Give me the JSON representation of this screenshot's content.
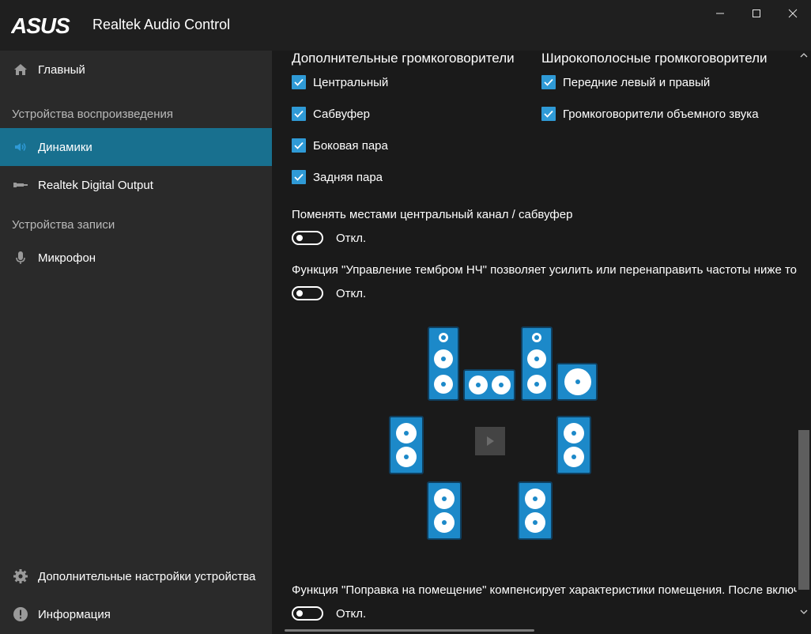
{
  "app": {
    "brand": "ASUS",
    "title": "Realtek Audio Control"
  },
  "window_controls": {
    "minimize_icon": "minimize-icon",
    "maximize_icon": "maximize-icon",
    "close_icon": "close-icon"
  },
  "sidebar": {
    "home": {
      "label": "Главный",
      "icon": "home-icon"
    },
    "playback_section": "Устройства воспроизведения",
    "playback_items": [
      {
        "label": "Динамики",
        "icon": "speaker-icon",
        "active": true
      },
      {
        "label": "Realtek Digital Output",
        "icon": "digital-output-icon",
        "active": false
      }
    ],
    "recording_section": "Устройства записи",
    "recording_items": [
      {
        "label": "Микрофон",
        "icon": "microphone-icon"
      }
    ],
    "footer_items": [
      {
        "label": "Дополнительные настройки устройства",
        "icon": "gear-icon"
      },
      {
        "label": "Информация",
        "icon": "info-icon"
      }
    ]
  },
  "content": {
    "additional_speakers": {
      "title": "Дополнительные громкоговорители",
      "items": [
        {
          "label": "Центральный",
          "checked": true
        },
        {
          "label": "Сабвуфер",
          "checked": true
        },
        {
          "label": "Боковая пара",
          "checked": true
        },
        {
          "label": "Задняя пара",
          "checked": true
        }
      ]
    },
    "fullrange_speakers": {
      "title": "Широкополосные громкоговорители",
      "items": [
        {
          "label": "Передние левый и правый",
          "checked": true
        },
        {
          "label": "Громкоговорители объемного звука",
          "checked": true
        }
      ]
    },
    "swap_center_sub": {
      "text": "Поменять местами центральный канал / сабвуфер",
      "state_label": "Откл."
    },
    "bass_management": {
      "text": "Функция \"Управление тембром НЧ\" позволяет усилить или перенаправить частоты ниже точк",
      "state_label": "Откл."
    },
    "room_correction": {
      "text": "Функция \"Поправка на помещение\" компенсирует характеристики помещения. После включе",
      "state_label": "Откл."
    },
    "speaker_test": {
      "play_icon": "play-icon"
    }
  },
  "colors": {
    "accent": "#2f9ad6",
    "active_nav": "#18708f",
    "speaker": "#1c89c9",
    "sidebar_bg": "#2a2a2a",
    "content_bg": "#1a1a1a"
  }
}
